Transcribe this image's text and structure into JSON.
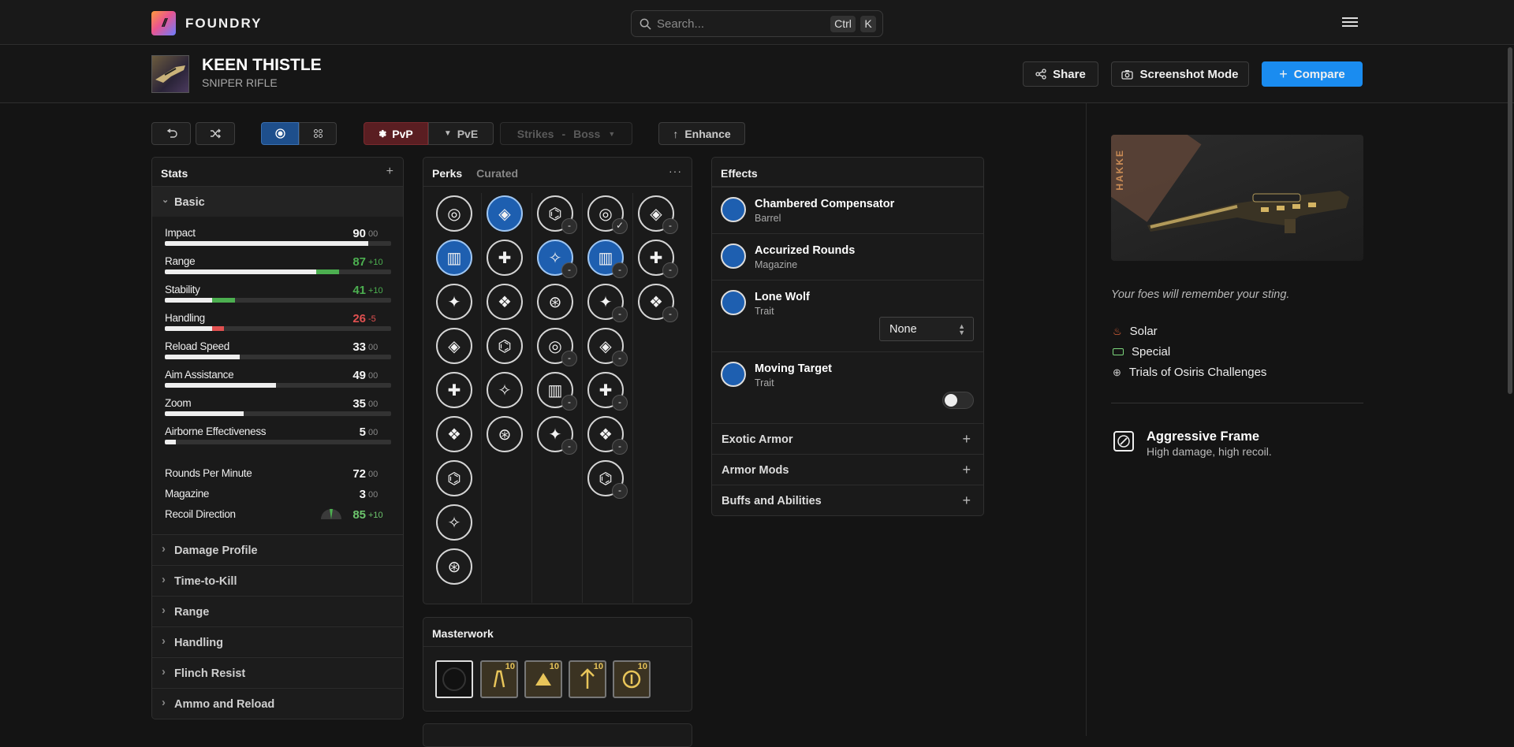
{
  "app": {
    "brand": "FOUNDRY",
    "logo_glyph": "//"
  },
  "search": {
    "placeholder": "Search...",
    "key1": "Ctrl",
    "key2": "K"
  },
  "weapon": {
    "name": "KEEN THISTLE",
    "type": "SNIPER RIFLE"
  },
  "header_actions": {
    "share": "Share",
    "screenshot": "Screenshot Mode",
    "compare": "Compare"
  },
  "toolbar": {
    "pvp": "PvP",
    "pve": "PvE",
    "strikes": "Strikes",
    "dash": "-",
    "boss": "Boss",
    "enhance": "Enhance"
  },
  "stats": {
    "title": "Stats",
    "basic": "Basic",
    "rows": [
      {
        "label": "Impact",
        "value": "90",
        "bonus": "00",
        "fill": 0.9,
        "delta": 0,
        "delta_color": ""
      },
      {
        "label": "Range",
        "value": "87",
        "bonus": "+10",
        "fill": 0.77,
        "delta": 0.1,
        "delta_color": "#4caf50"
      },
      {
        "label": "Stability",
        "value": "41",
        "bonus": "+10",
        "fill": 0.31,
        "delta": 0.1,
        "delta_color": "#4caf50"
      },
      {
        "label": "Handling",
        "value": "26",
        "bonus": "-5",
        "fill": 0.21,
        "delta": 0.05,
        "delta_color": "#e05050"
      },
      {
        "label": "Reload Speed",
        "value": "33",
        "bonus": "00",
        "fill": 0.33,
        "delta": 0,
        "delta_color": ""
      },
      {
        "label": "Aim Assistance",
        "value": "49",
        "bonus": "00",
        "fill": 0.49,
        "delta": 0,
        "delta_color": ""
      },
      {
        "label": "Zoom",
        "value": "35",
        "bonus": "00",
        "fill": 0.35,
        "delta": 0,
        "delta_color": ""
      },
      {
        "label": "Airborne Effectiveness",
        "value": "5",
        "bonus": "00",
        "fill": 0.05,
        "delta": 0,
        "delta_color": ""
      }
    ],
    "rpm": {
      "label": "Rounds Per Minute",
      "value": "72",
      "bonus": "00"
    },
    "mag": {
      "label": "Magazine",
      "value": "3",
      "bonus": "00"
    },
    "recoil": {
      "label": "Recoil Direction",
      "value": "85",
      "bonus": "+10"
    },
    "sections": [
      "Damage Profile",
      "Time-to-Kill",
      "Range",
      "Handling",
      "Flinch Resist",
      "Ammo and Reload"
    ]
  },
  "perks": {
    "tab_perks": "Perks",
    "tab_curated": "Curated",
    "more": "···",
    "minus": "-",
    "check": "✓",
    "icons": [
      "barrel-icon",
      "magazine-icon",
      "crosshair-icon",
      "armor-icon",
      "wings-icon"
    ]
  },
  "masterwork": {
    "title": "Masterwork",
    "level": "10"
  },
  "effects": {
    "title": "Effects",
    "items": [
      {
        "name": "Chambered Compensator",
        "sub": "Barrel"
      },
      {
        "name": "Accurized Rounds",
        "sub": "Magazine"
      },
      {
        "name": "Lone Wolf",
        "sub": "Trait"
      },
      {
        "name": "Moving Target",
        "sub": "Trait"
      }
    ],
    "lone_wolf_select": "None",
    "sections": [
      "Exotic Armor",
      "Armor Mods",
      "Buffs and Abilities"
    ]
  },
  "details": {
    "watermark": "HAKKE",
    "flavor": "Your foes will remember your sting.",
    "element": "Solar",
    "ammo": "Special",
    "source": "Trials of Osiris Challenges",
    "frame_name": "Aggressive Frame",
    "frame_desc": "High damage, high recoil.",
    "colors": {
      "solar": "#f06a3c",
      "special": "#7dd87d",
      "accent": "#1a8cf0"
    }
  }
}
